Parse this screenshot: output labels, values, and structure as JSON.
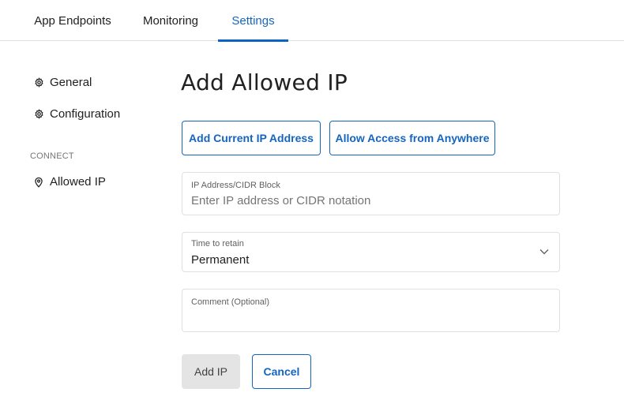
{
  "topnav": {
    "tabs": [
      {
        "label": "App Endpoints",
        "active": false
      },
      {
        "label": "Monitoring",
        "active": false
      },
      {
        "label": "Settings",
        "active": true
      }
    ]
  },
  "sidebar": {
    "items": [
      {
        "label": "General",
        "icon": "gear-icon"
      },
      {
        "label": "Configuration",
        "icon": "gear-icon"
      }
    ],
    "section_label": "CONNECT",
    "section_items": [
      {
        "label": "Allowed IP",
        "icon": "location-pin-icon"
      }
    ]
  },
  "main": {
    "title": "Add Allowed IP",
    "quick_buttons": {
      "add_current": "Add Current IP Address",
      "allow_anywhere": "Allow Access from Anywhere"
    },
    "fields": {
      "ip": {
        "label": "IP Address/CIDR Block",
        "placeholder": "Enter IP address or CIDR notation",
        "value": ""
      },
      "time": {
        "label": "Time to retain",
        "value": "Permanent"
      },
      "comment": {
        "label": "Comment (Optional)",
        "value": ""
      }
    },
    "actions": {
      "add": "Add IP",
      "cancel": "Cancel"
    }
  },
  "colors": {
    "accent": "#1565c0",
    "disabled_bg": "#e4e4e4",
    "border": "#e0e0e0"
  }
}
